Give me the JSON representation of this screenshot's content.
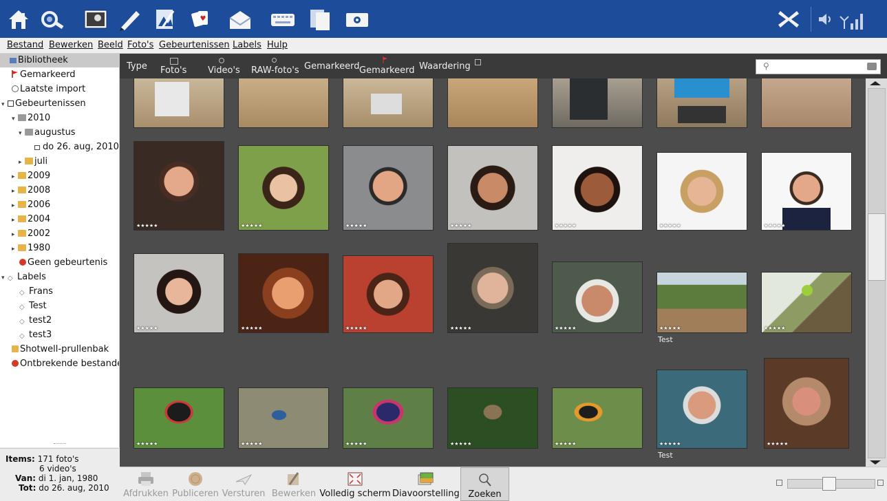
{
  "topbar": {
    "launcher_icons": [
      "home-icon",
      "gear-search-icon",
      "photo-viewer-icon",
      "text-editor-icon",
      "image-editor-icon",
      "cards-icon",
      "mail-icon",
      "keyboard-icon",
      "files-icon",
      "media-icon"
    ],
    "right_icons": [
      "close-icon",
      "volume-icon",
      "signal-icon"
    ],
    "colors": {
      "bar": "#1d4d9a"
    }
  },
  "menubar": {
    "items": [
      "Bestand",
      "Bewerken",
      "Beeld",
      "Foto's",
      "Gebeurtenissen",
      "Labels",
      "Hulp"
    ]
  },
  "sidebar": {
    "items": [
      {
        "label": "Bibliotheek",
        "icon": "library-icon",
        "selected": true
      },
      {
        "label": "Gemarkeerd",
        "icon": "flag-icon"
      },
      {
        "label": "Laatste import",
        "icon": "import-icon"
      },
      {
        "label": "Gebeurtenissen",
        "icon": "events-icon",
        "expander": "▾"
      },
      {
        "label": "2010",
        "icon": "folder-icon",
        "expander": "▾"
      },
      {
        "label": "augustus",
        "icon": "folder-icon",
        "expander": "▾"
      },
      {
        "label": "do 26. aug, 2010",
        "icon": "event-icon"
      },
      {
        "label": "juli",
        "icon": "folder-icon",
        "expander": "▸"
      },
      {
        "label": "2009",
        "icon": "folder-icon",
        "expander": "▸"
      },
      {
        "label": "2008",
        "icon": "folder-icon",
        "expander": "▸"
      },
      {
        "label": "2006",
        "icon": "folder-icon",
        "expander": "▸"
      },
      {
        "label": "2004",
        "icon": "folder-icon",
        "expander": "▸"
      },
      {
        "label": "2002",
        "icon": "folder-icon",
        "expander": "▸"
      },
      {
        "label": "1980",
        "icon": "folder-icon",
        "expander": "▸"
      },
      {
        "label": "Geen gebeurtenis",
        "icon": "no-event-icon"
      },
      {
        "label": "Labels",
        "icon": "labels-icon",
        "expander": "▾"
      },
      {
        "label": "Frans",
        "icon": "tag-icon"
      },
      {
        "label": "Test",
        "icon": "tag-icon"
      },
      {
        "label": "test2",
        "icon": "tag-icon"
      },
      {
        "label": "test3",
        "icon": "tag-icon"
      },
      {
        "label": "Shotwell-prullenbak",
        "icon": "trash-icon"
      },
      {
        "label": "Ontbrekende bestanden",
        "icon": "missing-icon"
      }
    ],
    "stats": {
      "items_label": "Items:",
      "items_photos": "171 foto's",
      "items_videos": "6 video's",
      "from_label": "Van:",
      "from_value": "di 1. jan, 1980",
      "to_label": "Tot:",
      "to_value": "do 26. aug, 2010"
    }
  },
  "filterbar": {
    "type_label": "Type",
    "photos": "Foto's",
    "videos": "Video's",
    "raw": "RAW-foto's",
    "flagged": "Gemarkeerd",
    "flagged2": "Gemarkeerd",
    "rating": "Waardering",
    "search_value": ""
  },
  "grid": {
    "stars": "★★★★★",
    "captions": {
      "r2c6": "Test",
      "r3c6": "Test"
    },
    "colors": {
      "bg": "#4c4c4c"
    }
  },
  "toolbar": {
    "buttons": [
      {
        "label": "Afdrukken",
        "icon": "print-icon",
        "enabled": false
      },
      {
        "label": "Publiceren",
        "icon": "publish-icon",
        "enabled": false
      },
      {
        "label": "Versturen",
        "icon": "send-icon",
        "enabled": false
      },
      {
        "label": "Bewerken",
        "icon": "edit-icon",
        "enabled": false
      },
      {
        "label": "Volledig scherm",
        "icon": "fullscreen-icon",
        "enabled": true
      },
      {
        "label": "Diavoorstelling",
        "icon": "slideshow-icon",
        "enabled": true
      },
      {
        "label": "Zoeken",
        "icon": "search-icon",
        "enabled": true,
        "active": true
      }
    ],
    "zoom_level": 0.47
  }
}
